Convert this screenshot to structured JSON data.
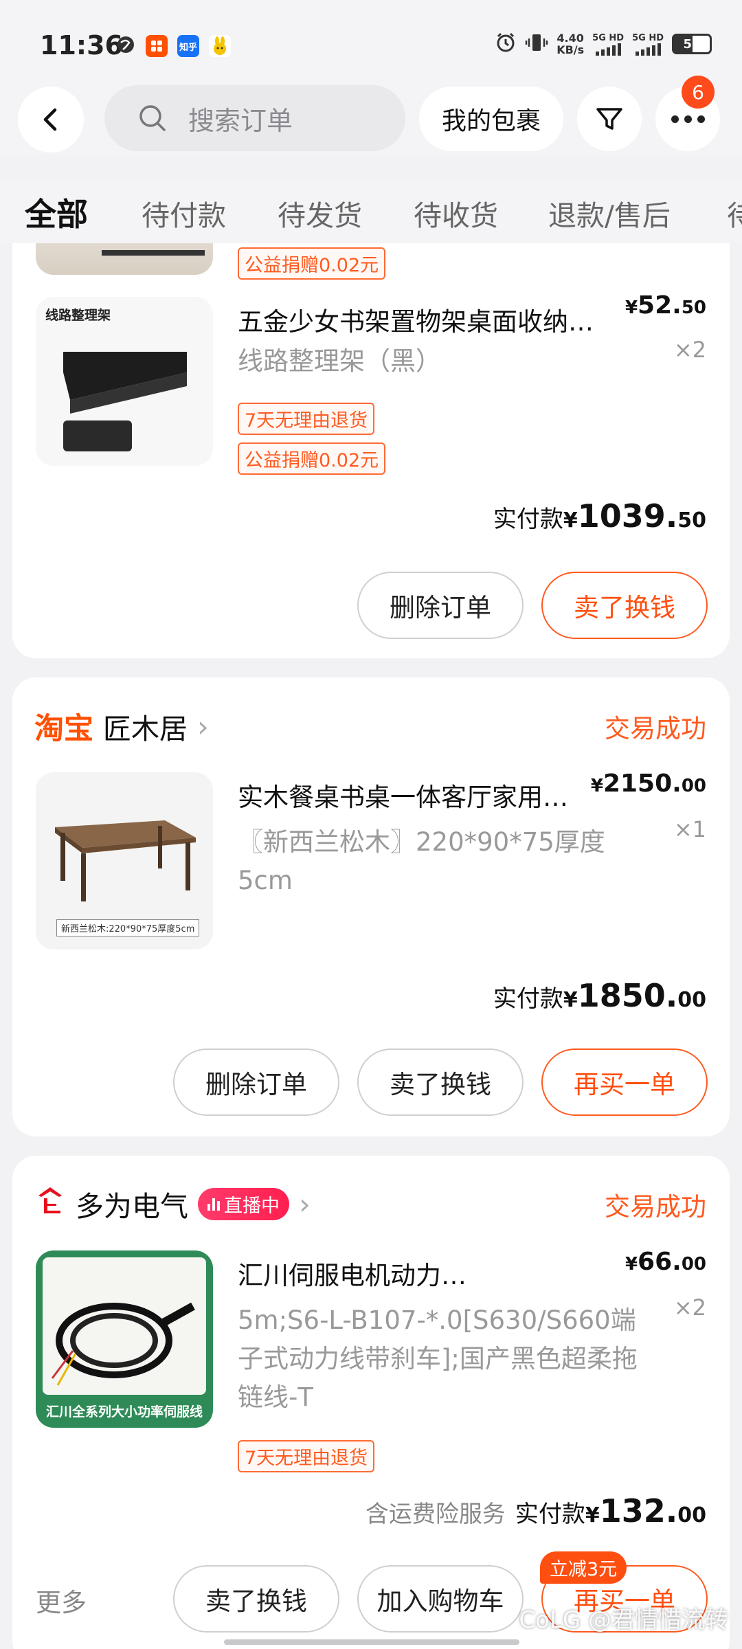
{
  "status_bar": {
    "time": "11:36",
    "net_speed_value": "4.40",
    "net_speed_unit": "KB/s",
    "sim1": "5G HD",
    "sim2": "5G HD",
    "battery": "51",
    "app_icons": [
      "globe-icon",
      "taobao-app-icon",
      "zhihu-app-icon",
      "bunny-app-icon"
    ],
    "zhihu_label": "知乎"
  },
  "topbar": {
    "search_placeholder": "搜索订单",
    "parcel_label": "我的包裹",
    "more_badge": "6"
  },
  "tabs": [
    "全部",
    "待付款",
    "待发货",
    "待收货",
    "退款/售后",
    "待"
  ],
  "order1": {
    "top_partial_tag": "公益捐赠0.02元",
    "item_title": "五金少女书架置物架桌面收纳…",
    "item_spec": "线路整理架（黑）",
    "price_yen": "¥",
    "price_main": "52.",
    "price_dec": "50",
    "qty": "×2",
    "tags": [
      "7天无理由退货",
      "公益捐赠0.02元"
    ],
    "thumb_caption": "线路整理架",
    "paid_label": "实付款",
    "paid_yen": "¥",
    "paid_main": "1039.",
    "paid_dec": "50",
    "buttons": [
      "删除订单",
      "卖了换钱"
    ]
  },
  "order2": {
    "platform": "淘宝",
    "shop_name": "匠木居",
    "status": "交易成功",
    "item_title": "实木餐桌书桌一体客厅家用…",
    "item_spec": "〖新西兰松木〗220*90*75厚度5cm",
    "price_yen": "¥",
    "price_main": "2150.",
    "price_dec": "00",
    "qty": "×1",
    "thumb_caption": "新西兰松木:220*90*75厚度5cm",
    "paid_label": "实付款",
    "paid_yen": "¥",
    "paid_main": "1850.",
    "paid_dec": "00",
    "buttons": [
      "删除订单",
      "卖了换钱",
      "再买一单"
    ]
  },
  "order3": {
    "shop_name": "多为电气",
    "live_label": "直播中",
    "status": "交易成功",
    "item_title": "汇川伺服电机动力…",
    "item_spec": "5m;S6-L-B107-*.0[S630/S660端子式动力线带刹车];国产黑色超柔拖链线-T",
    "price_yen": "¥",
    "price_main": "66.",
    "price_dec": "00",
    "qty": "×2",
    "tags": [
      "7天无理由退货"
    ],
    "thumb_caption": "汇川全系列大小功率伺服线",
    "insurance": "含运费险服务",
    "paid_label": "实付款",
    "paid_yen": "¥",
    "paid_main": "132.",
    "paid_dec": "00",
    "more_label": "更多",
    "discount_badge": "立减3元",
    "buttons": [
      "卖了换钱",
      "加入购物车",
      "再买一单"
    ]
  },
  "watermark": "CoLG @君情惜流转",
  "colors": {
    "accent": "#ff5a1f",
    "background": "#f2f2f4"
  }
}
